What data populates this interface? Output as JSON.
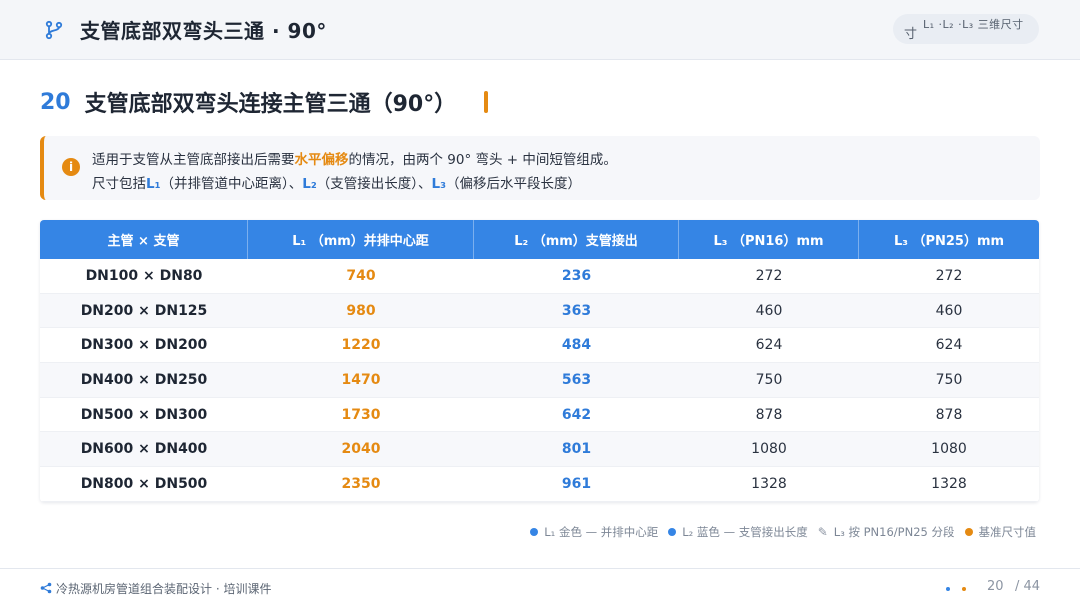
{
  "header": {
    "title": "支管底部双弯头三通 · 90°",
    "pill_text": "L₁ ·L₂ ·L₃ 三维尺寸"
  },
  "section": {
    "number": "20",
    "title": "支管底部双弯头连接主管三通（90°）"
  },
  "info": {
    "line1_a": "适用于支管从主管底部接出后需要",
    "line1_hl": "水平偏移",
    "line1_b": "的情况，由两个 90° 弯头 + 中间短管组成。",
    "line2_a": "尺寸包括",
    "l1": "L₁",
    "line2_b": "（并排管道中心距离）、",
    "l2": "L₂",
    "line2_c": "（支管接出长度）、",
    "l3": "L₃",
    "line2_d": "（偏移后水平段长度）"
  },
  "table": {
    "headers": [
      "主管 × 支管",
      "L₁ （mm）并排中心距",
      "L₂ （mm）支管接出",
      "L₃ （PN16）mm",
      "L₃ （PN25）mm"
    ],
    "rows": [
      [
        "DN100 × DN80",
        "740",
        "236",
        "272",
        "272"
      ],
      [
        "DN200 × DN125",
        "980",
        "363",
        "460",
        "460"
      ],
      [
        "DN300 × DN200",
        "1220",
        "484",
        "624",
        "624"
      ],
      [
        "DN400 × DN250",
        "1470",
        "563",
        "750",
        "750"
      ],
      [
        "DN500 × DN300",
        "1730",
        "642",
        "878",
        "878"
      ],
      [
        "DN600 × DN400",
        "2040",
        "801",
        "1080",
        "1080"
      ],
      [
        "DN800 × DN500",
        "2350",
        "961",
        "1328",
        "1328"
      ]
    ]
  },
  "legend": {
    "item1": "L₁ 金色 — 并排中心距",
    "item2": "L₂ 蓝色 — 支管接出长度",
    "item3": "L₃ 按 PN16/PN25 分段",
    "item4": "基准尺寸值"
  },
  "footer": {
    "text": "冷热源机房管道组合装配设计 · 培训课件",
    "page": "20",
    "total": "/ 44"
  },
  "colors": {
    "accent_blue": "#3585e5",
    "accent_orange": "#e58a12",
    "text_dark": "#1e2633"
  }
}
